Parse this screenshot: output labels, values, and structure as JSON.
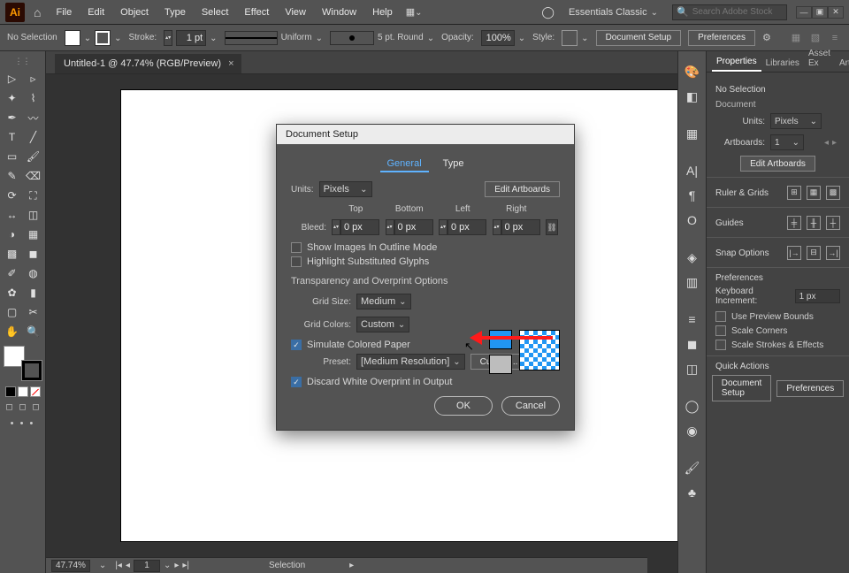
{
  "menubar": {
    "items": [
      "File",
      "Edit",
      "Object",
      "Type",
      "Select",
      "Effect",
      "View",
      "Window",
      "Help"
    ],
    "workspace": "Essentials Classic",
    "search_placeholder": "Search Adobe Stock"
  },
  "ctrlbar": {
    "no_selection": "No Selection",
    "stroke_label": "Stroke:",
    "stroke_val": "1 pt",
    "uniform": "Uniform",
    "brush": "5 pt. Round",
    "opacity_label": "Opacity:",
    "opacity_val": "100%",
    "style_label": "Style:",
    "document_setup": "Document Setup",
    "preferences": "Preferences"
  },
  "doc_tab": {
    "label": "Untitled-1 @ 47.74% (RGB/Preview)"
  },
  "statusbar": {
    "zoom": "47.74%",
    "artboard": "1",
    "mode": "Selection"
  },
  "dialog": {
    "title": "Document Setup",
    "tabs": {
      "general": "General",
      "type": "Type"
    },
    "units_label": "Units:",
    "units_value": "Pixels",
    "edit_artboards": "Edit Artboards",
    "bleed_label": "Bleed:",
    "bleed_hdr": [
      "Top",
      "Bottom",
      "Left",
      "Right"
    ],
    "bleed_vals": [
      "0 px",
      "0 px",
      "0 px",
      "0 px"
    ],
    "show_images": "Show Images In Outline Mode",
    "highlight_glyphs": "Highlight Substituted Glyphs",
    "transparency_title": "Transparency and Overprint Options",
    "grid_size_label": "Grid Size:",
    "grid_size_value": "Medium",
    "grid_colors_label": "Grid Colors:",
    "grid_colors_value": "Custom",
    "simulate": "Simulate Colored Paper",
    "preset_label": "Preset:",
    "preset_value": "[Medium Resolution]",
    "custom_btn": "Custom...",
    "discard": "Discard White Overprint in Output",
    "ok": "OK",
    "cancel": "Cancel"
  },
  "properties": {
    "tabs": [
      "Properties",
      "Libraries",
      "Asset Ex",
      "Artboard"
    ],
    "no_selection": "No Selection",
    "document_hdr": "Document",
    "units_label": "Units:",
    "units_value": "Pixels",
    "artboards_label": "Artboards:",
    "artboards_value": "1",
    "edit_artboards": "Edit Artboards",
    "ruler_hdr": "Ruler & Grids",
    "guides_hdr": "Guides",
    "snap_hdr": "Snap Options",
    "prefs_hdr": "Preferences",
    "keyboard_label": "Keyboard Increment:",
    "keyboard_value": "1 px",
    "use_preview": "Use Preview Bounds",
    "scale_corners": "Scale Corners",
    "scale_strokes": "Scale Strokes & Effects",
    "quick_hdr": "Quick Actions",
    "document_setup": "Document Setup",
    "preferences": "Preferences"
  }
}
